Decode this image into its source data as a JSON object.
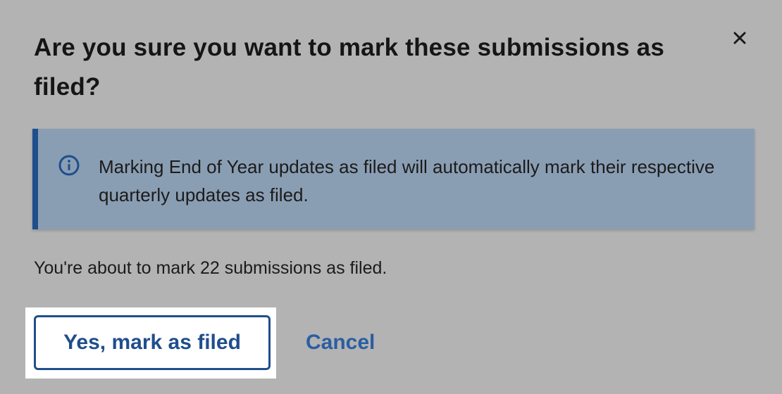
{
  "dialog": {
    "title": "Are you sure you want to mark these submissions as filed?",
    "close_icon": "close-icon"
  },
  "notice": {
    "icon": "info-icon",
    "text": "Marking End of Year updates as filed will automatically mark their respective quarterly updates as filed."
  },
  "summary": {
    "text": "You're about to mark 22 submissions as filed."
  },
  "actions": {
    "confirm_label": "Yes, mark as filed",
    "cancel_label": "Cancel"
  },
  "colors": {
    "backdrop": "#b3b3b3",
    "accent": "#1f4e8c",
    "notice_bg": "#8a9eb3"
  }
}
